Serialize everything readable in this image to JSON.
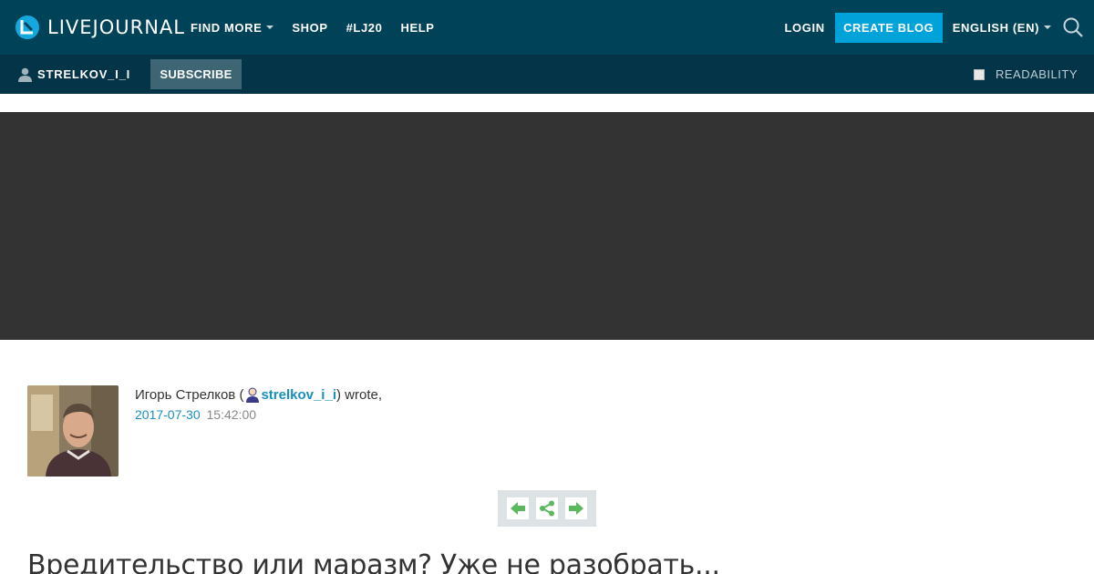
{
  "header": {
    "logo_text": "LIVEJOURNAL",
    "nav": [
      {
        "label": "FIND MORE",
        "has_dropdown": true
      },
      {
        "label": "SHOP",
        "has_dropdown": false
      },
      {
        "label": "#LJ20",
        "has_dropdown": false
      },
      {
        "label": "HELP",
        "has_dropdown": false
      }
    ],
    "login_label": "LOGIN",
    "create_blog_label": "CREATE BLOG",
    "language_label": "ENGLISH (EN)",
    "search_icon": "search-icon"
  },
  "subheader": {
    "username": "STRELKOV_I_I",
    "subscribe_label": "SUBSCRIBE",
    "readability_label": "READABILITY"
  },
  "post": {
    "author_name": "Игорь Стрелков (",
    "author_username": "strelkov_i_i",
    "wrote_suffix": ") wrote,",
    "date": "2017-07-30",
    "time": "15:42:00",
    "title": "Вредительство или маразм? Уже не разобрать..."
  },
  "colors": {
    "header_bg": "#004359",
    "subheader_bg": "#033447",
    "accent": "#00a3d9",
    "banner_bg": "#333333",
    "link": "#1a8fbf",
    "nav_arrow_green": "#5cb85c"
  }
}
